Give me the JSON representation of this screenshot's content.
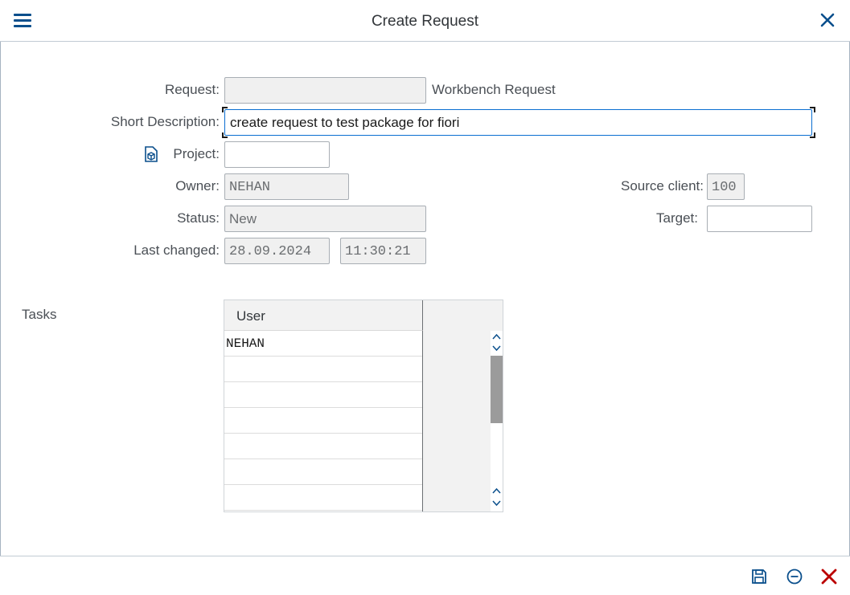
{
  "window": {
    "title": "Create Request"
  },
  "icons": {
    "menu": "hamburger-menu-icon",
    "close": "close-icon",
    "project": "project-cube-icon",
    "save": "save-icon",
    "cancel": "minus-circle-icon",
    "exit": "close-icon"
  },
  "colors": {
    "accent": "#0a4f8c",
    "exit": "#bb0000",
    "focus_border": "#0a6ed1",
    "readonly_bg": "#f0f0f0"
  },
  "form": {
    "request": {
      "label": "Request:",
      "value": "",
      "type_text": "Workbench Request"
    },
    "short_description": {
      "label": "Short Description:",
      "value": "create request to test package for fiori"
    },
    "project": {
      "label": "Project:",
      "value": ""
    },
    "owner": {
      "label": "Owner:",
      "value": "NEHAN"
    },
    "source_client": {
      "label": "Source client:",
      "value": "100"
    },
    "status": {
      "label": "Status:",
      "value": "New"
    },
    "target": {
      "label": "Target:",
      "value": ""
    },
    "last_changed": {
      "label": "Last changed:",
      "date": "28.09.2024",
      "time": "11:30:21"
    }
  },
  "tasks": {
    "label": "Tasks",
    "columns": [
      "User"
    ],
    "rows": [
      "NEHAN",
      "",
      "",
      "",
      "",
      "",
      ""
    ]
  }
}
